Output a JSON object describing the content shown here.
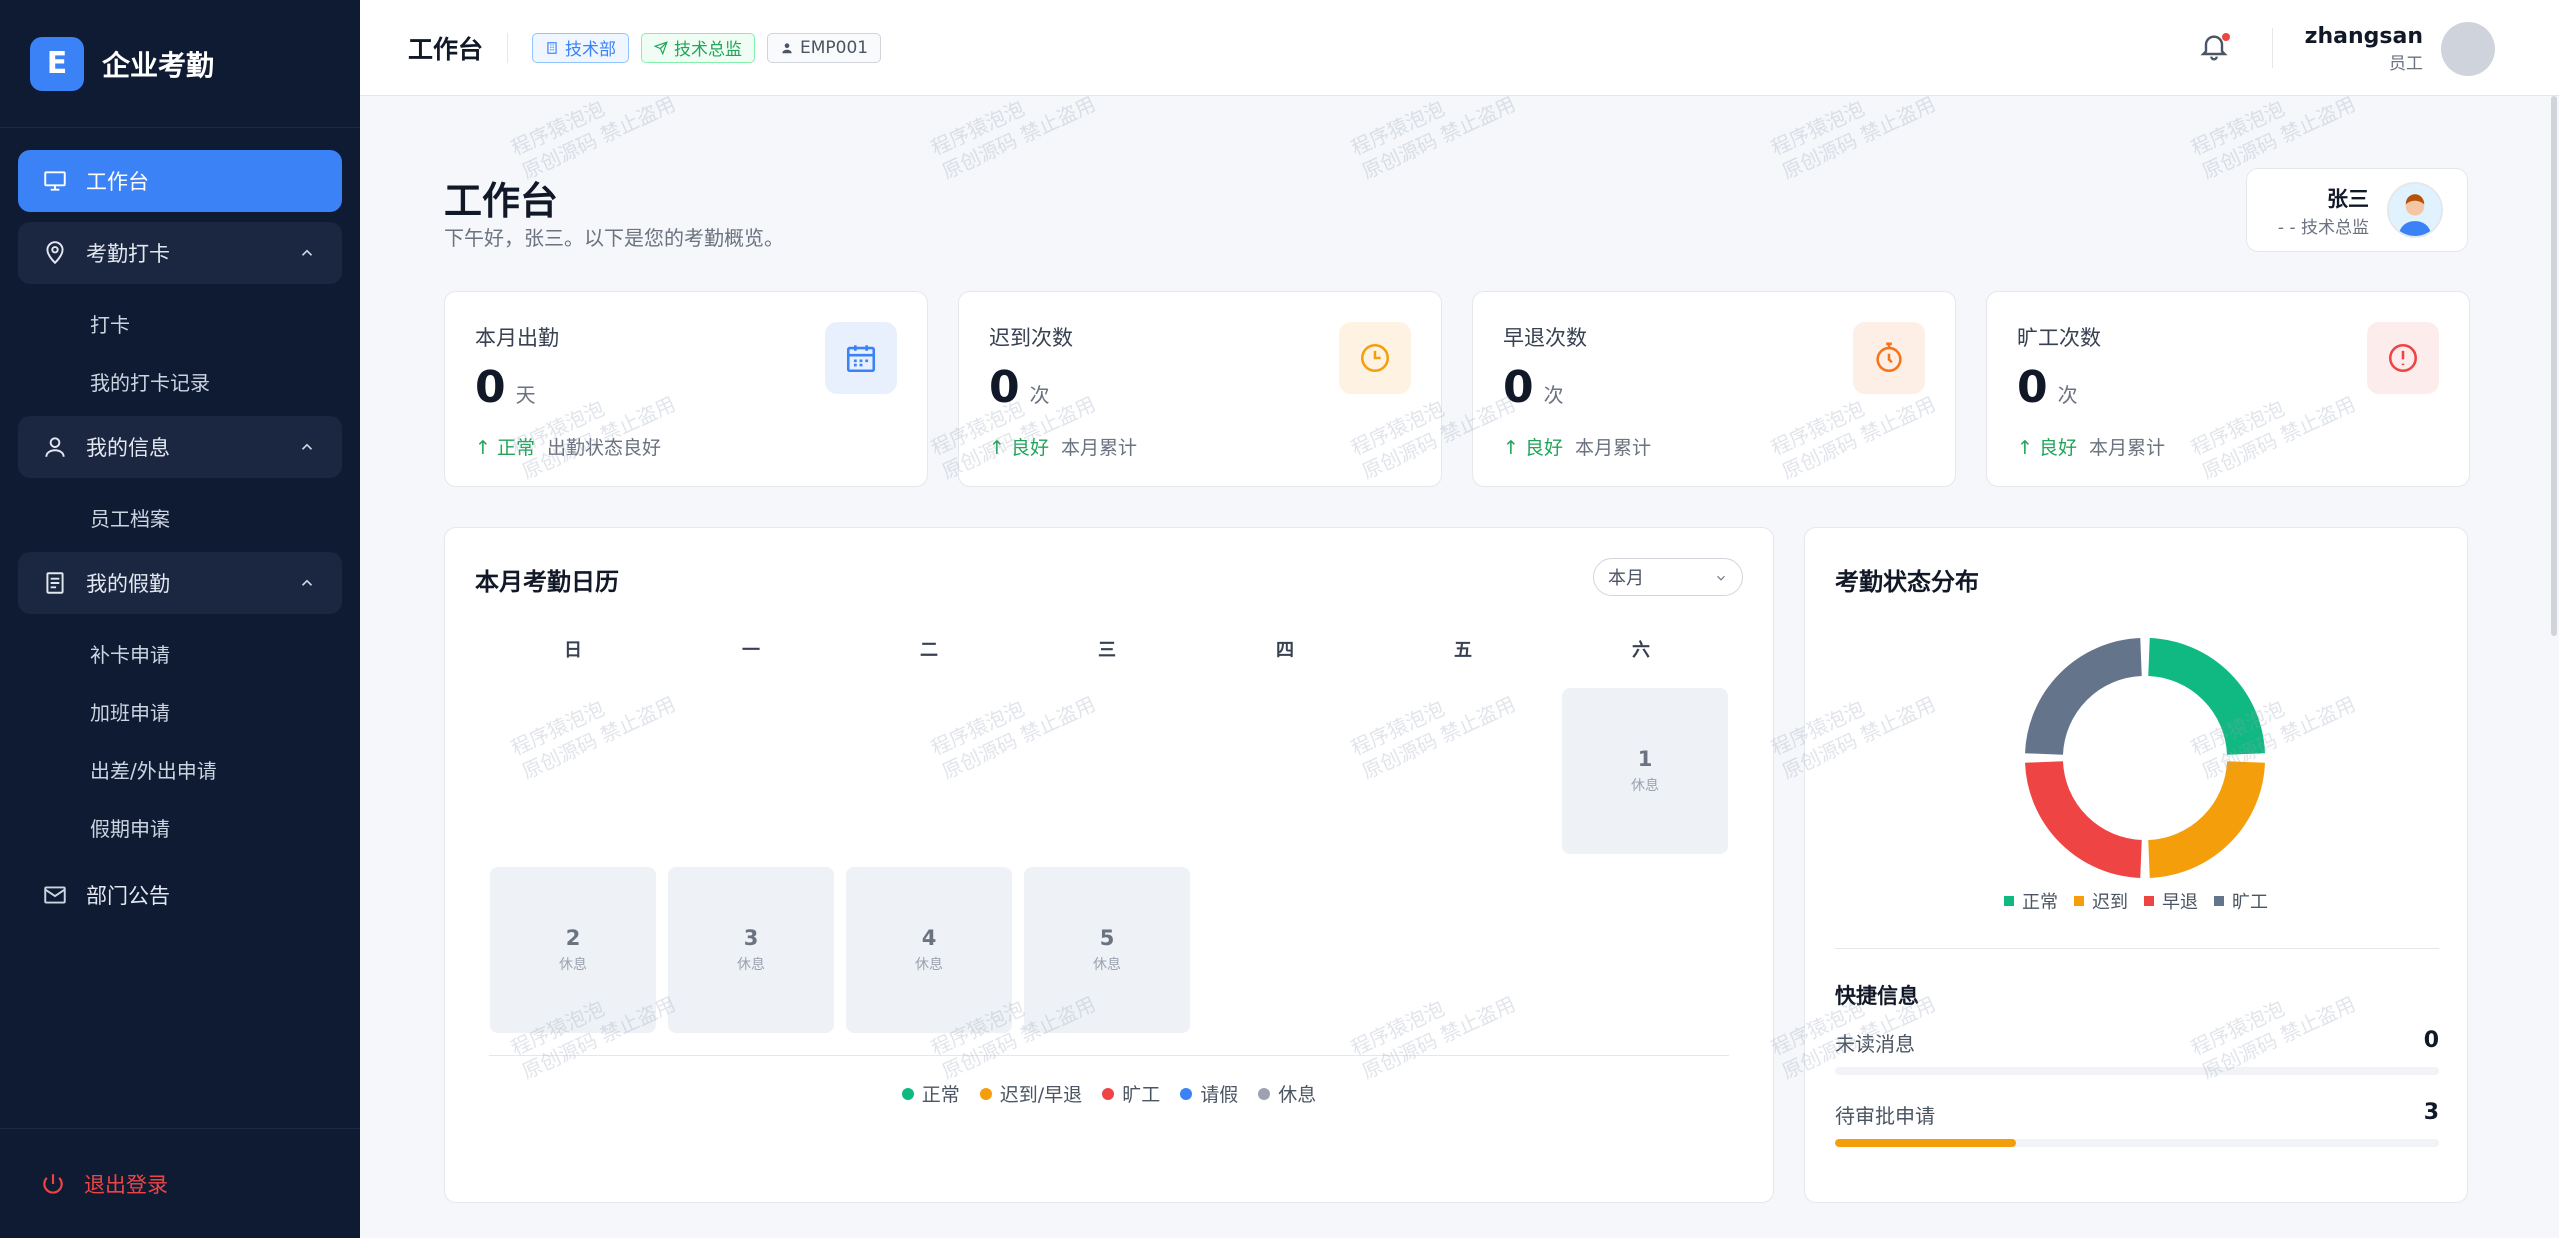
{
  "brand": {
    "logo_letter": "E",
    "name": "企业考勤"
  },
  "sidebar": {
    "workbench": "工作台",
    "attendance_group": "考勤打卡",
    "attendance_items": [
      "打卡",
      "我的打卡记录"
    ],
    "info_group": "我的信息",
    "info_items": [
      "员工档案"
    ],
    "leave_group": "我的假勤",
    "leave_items": [
      "补卡申请",
      "加班申请",
      "出差/外出申请",
      "假期申请"
    ],
    "announcement": "部门公告",
    "logout": "退出登录"
  },
  "header": {
    "title": "工作台",
    "tag_dept": "技术部",
    "tag_position": "技术总监",
    "tag_emp_id": "EMP001",
    "username": "zhangsan",
    "role": "员工"
  },
  "page": {
    "title": "工作台",
    "subtitle": "下午好，张三。以下是您的考勤概览。",
    "profile_name": "张三",
    "profile_role": "- - 技术总监"
  },
  "stats": [
    {
      "label": "本月出勤",
      "value": "0",
      "unit": "天",
      "good": "↑ 正常",
      "note": "出勤状态良好"
    },
    {
      "label": "迟到次数",
      "value": "0",
      "unit": "次",
      "good": "↑ 良好",
      "note": "本月累计"
    },
    {
      "label": "早退次数",
      "value": "0",
      "unit": "次",
      "good": "↑ 良好",
      "note": "本月累计"
    },
    {
      "label": "旷工次数",
      "value": "0",
      "unit": "次",
      "good": "↑ 良好",
      "note": "本月累计"
    }
  ],
  "colors": {
    "blue": "#3b82f6",
    "orange": "#f59e0b",
    "red": "#ef4444",
    "green": "#10b981",
    "slate": "#64748b",
    "gray": "#9ca3af"
  },
  "calendar": {
    "title": "本月考勤日历",
    "select_value": "本月",
    "weekdays": [
      "日",
      "一",
      "二",
      "三",
      "四",
      "五",
      "六"
    ],
    "days": [
      {
        "num": "1",
        "status": "休息"
      },
      {
        "num": "2",
        "status": "休息"
      },
      {
        "num": "3",
        "status": "休息"
      },
      {
        "num": "4",
        "status": "休息"
      },
      {
        "num": "5",
        "status": "休息"
      }
    ],
    "legend": [
      "正常",
      "迟到/早退",
      "旷工",
      "请假",
      "休息"
    ]
  },
  "distribution": {
    "title": "考勤状态分布",
    "legend": [
      "正常",
      "迟到",
      "早退",
      "旷工"
    ]
  },
  "quick": {
    "title": "快捷信息",
    "unread_label": "未读消息",
    "unread_value": "0",
    "unread_progress": 0,
    "pending_label": "待审批申请",
    "pending_value": "3",
    "pending_progress": 0.3
  },
  "watermark": {
    "line1": "程序猿泡泡",
    "line2": "原创源码 禁止盗用"
  }
}
